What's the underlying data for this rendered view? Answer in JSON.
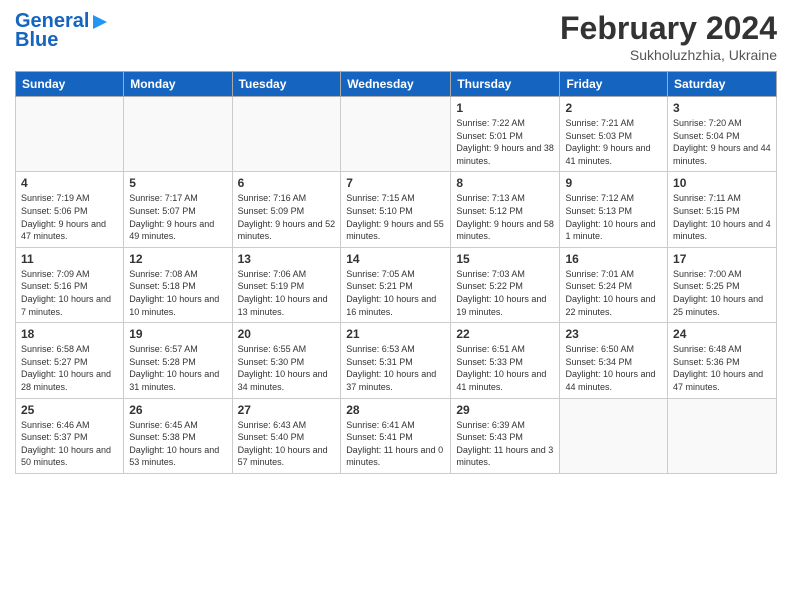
{
  "header": {
    "logo_line1": "General",
    "logo_line2": "Blue",
    "month": "February 2024",
    "location": "Sukholuzhzhia, Ukraine"
  },
  "weekdays": [
    "Sunday",
    "Monday",
    "Tuesday",
    "Wednesday",
    "Thursday",
    "Friday",
    "Saturday"
  ],
  "weeks": [
    [
      {
        "day": "",
        "info": ""
      },
      {
        "day": "",
        "info": ""
      },
      {
        "day": "",
        "info": ""
      },
      {
        "day": "",
        "info": ""
      },
      {
        "day": "1",
        "info": "Sunrise: 7:22 AM\nSunset: 5:01 PM\nDaylight: 9 hours\nand 38 minutes."
      },
      {
        "day": "2",
        "info": "Sunrise: 7:21 AM\nSunset: 5:03 PM\nDaylight: 9 hours\nand 41 minutes."
      },
      {
        "day": "3",
        "info": "Sunrise: 7:20 AM\nSunset: 5:04 PM\nDaylight: 9 hours\nand 44 minutes."
      }
    ],
    [
      {
        "day": "4",
        "info": "Sunrise: 7:19 AM\nSunset: 5:06 PM\nDaylight: 9 hours\nand 47 minutes."
      },
      {
        "day": "5",
        "info": "Sunrise: 7:17 AM\nSunset: 5:07 PM\nDaylight: 9 hours\nand 49 minutes."
      },
      {
        "day": "6",
        "info": "Sunrise: 7:16 AM\nSunset: 5:09 PM\nDaylight: 9 hours\nand 52 minutes."
      },
      {
        "day": "7",
        "info": "Sunrise: 7:15 AM\nSunset: 5:10 PM\nDaylight: 9 hours\nand 55 minutes."
      },
      {
        "day": "8",
        "info": "Sunrise: 7:13 AM\nSunset: 5:12 PM\nDaylight: 9 hours\nand 58 minutes."
      },
      {
        "day": "9",
        "info": "Sunrise: 7:12 AM\nSunset: 5:13 PM\nDaylight: 10 hours\nand 1 minute."
      },
      {
        "day": "10",
        "info": "Sunrise: 7:11 AM\nSunset: 5:15 PM\nDaylight: 10 hours\nand 4 minutes."
      }
    ],
    [
      {
        "day": "11",
        "info": "Sunrise: 7:09 AM\nSunset: 5:16 PM\nDaylight: 10 hours\nand 7 minutes."
      },
      {
        "day": "12",
        "info": "Sunrise: 7:08 AM\nSunset: 5:18 PM\nDaylight: 10 hours\nand 10 minutes."
      },
      {
        "day": "13",
        "info": "Sunrise: 7:06 AM\nSunset: 5:19 PM\nDaylight: 10 hours\nand 13 minutes."
      },
      {
        "day": "14",
        "info": "Sunrise: 7:05 AM\nSunset: 5:21 PM\nDaylight: 10 hours\nand 16 minutes."
      },
      {
        "day": "15",
        "info": "Sunrise: 7:03 AM\nSunset: 5:22 PM\nDaylight: 10 hours\nand 19 minutes."
      },
      {
        "day": "16",
        "info": "Sunrise: 7:01 AM\nSunset: 5:24 PM\nDaylight: 10 hours\nand 22 minutes."
      },
      {
        "day": "17",
        "info": "Sunrise: 7:00 AM\nSunset: 5:25 PM\nDaylight: 10 hours\nand 25 minutes."
      }
    ],
    [
      {
        "day": "18",
        "info": "Sunrise: 6:58 AM\nSunset: 5:27 PM\nDaylight: 10 hours\nand 28 minutes."
      },
      {
        "day": "19",
        "info": "Sunrise: 6:57 AM\nSunset: 5:28 PM\nDaylight: 10 hours\nand 31 minutes."
      },
      {
        "day": "20",
        "info": "Sunrise: 6:55 AM\nSunset: 5:30 PM\nDaylight: 10 hours\nand 34 minutes."
      },
      {
        "day": "21",
        "info": "Sunrise: 6:53 AM\nSunset: 5:31 PM\nDaylight: 10 hours\nand 37 minutes."
      },
      {
        "day": "22",
        "info": "Sunrise: 6:51 AM\nSunset: 5:33 PM\nDaylight: 10 hours\nand 41 minutes."
      },
      {
        "day": "23",
        "info": "Sunrise: 6:50 AM\nSunset: 5:34 PM\nDaylight: 10 hours\nand 44 minutes."
      },
      {
        "day": "24",
        "info": "Sunrise: 6:48 AM\nSunset: 5:36 PM\nDaylight: 10 hours\nand 47 minutes."
      }
    ],
    [
      {
        "day": "25",
        "info": "Sunrise: 6:46 AM\nSunset: 5:37 PM\nDaylight: 10 hours\nand 50 minutes."
      },
      {
        "day": "26",
        "info": "Sunrise: 6:45 AM\nSunset: 5:38 PM\nDaylight: 10 hours\nand 53 minutes."
      },
      {
        "day": "27",
        "info": "Sunrise: 6:43 AM\nSunset: 5:40 PM\nDaylight: 10 hours\nand 57 minutes."
      },
      {
        "day": "28",
        "info": "Sunrise: 6:41 AM\nSunset: 5:41 PM\nDaylight: 11 hours\nand 0 minutes."
      },
      {
        "day": "29",
        "info": "Sunrise: 6:39 AM\nSunset: 5:43 PM\nDaylight: 11 hours\nand 3 minutes."
      },
      {
        "day": "",
        "info": ""
      },
      {
        "day": "",
        "info": ""
      }
    ]
  ]
}
